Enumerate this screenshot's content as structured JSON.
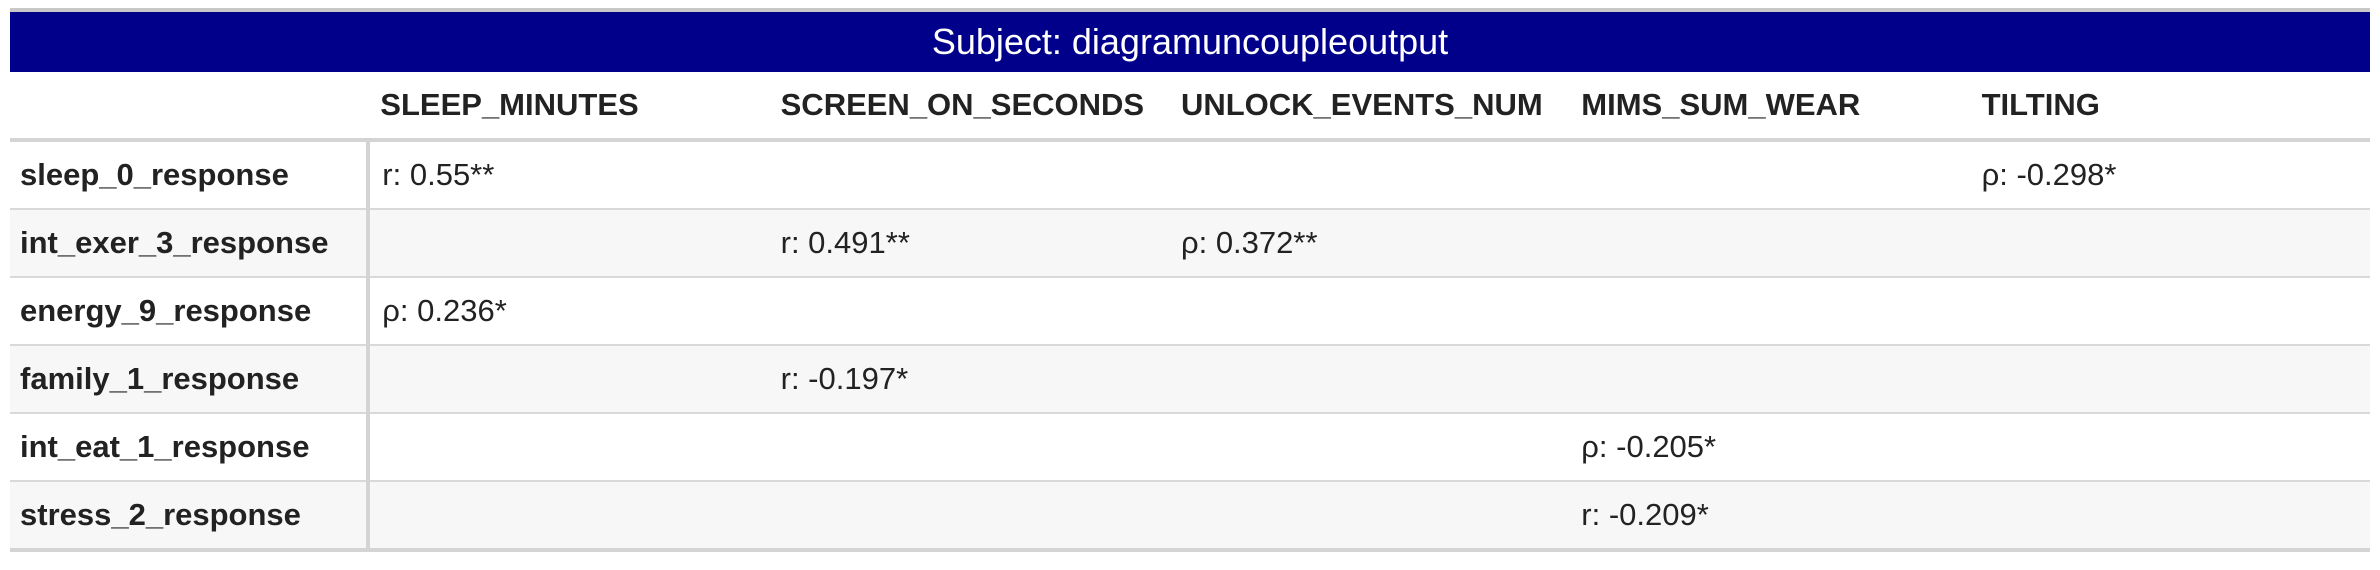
{
  "title": "Subject: diagramuncoupleoutput",
  "columns": [
    "SLEEP_MINUTES",
    "SCREEN_ON_SECONDS",
    "UNLOCK_EVENTS_NUM",
    "MIMS_SUM_WEAR",
    "TILTING"
  ],
  "rows": [
    {
      "label": "sleep_0_response",
      "cells": [
        "r: 0.55**",
        "",
        "",
        "",
        "ρ: -0.298*"
      ]
    },
    {
      "label": "int_exer_3_response",
      "cells": [
        "",
        "r: 0.491**",
        "ρ: 0.372**",
        "",
        ""
      ]
    },
    {
      "label": "energy_9_response",
      "cells": [
        "ρ: 0.236*",
        "",
        "",
        "",
        ""
      ]
    },
    {
      "label": "family_1_response",
      "cells": [
        "",
        "r: -0.197*",
        "",
        "",
        ""
      ]
    },
    {
      "label": "int_eat_1_response",
      "cells": [
        "",
        "",
        "",
        "ρ: -0.205*",
        ""
      ]
    },
    {
      "label": "stress_2_response",
      "cells": [
        "",
        "",
        "",
        "r: -0.209*",
        ""
      ]
    }
  ],
  "colors": {
    "title_background": "#00008b",
    "title_text": "#ffffff"
  }
}
